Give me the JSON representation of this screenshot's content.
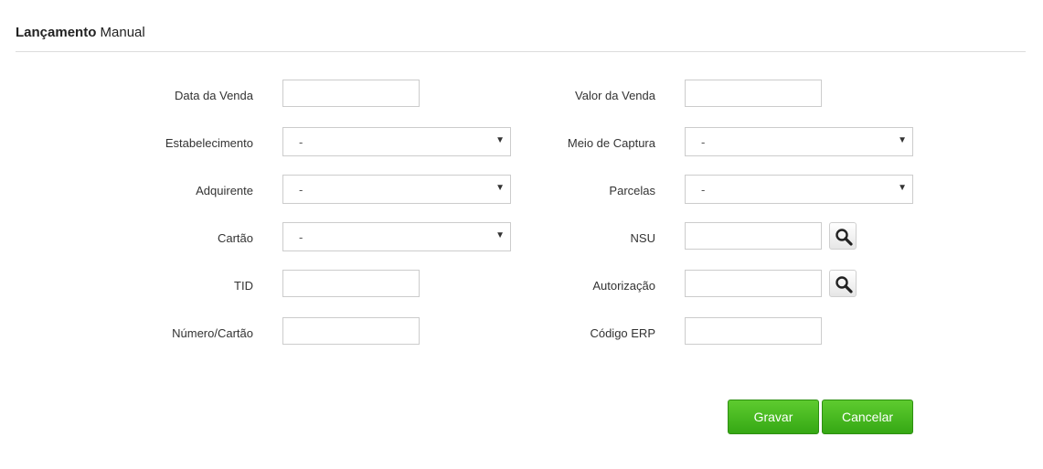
{
  "header": {
    "title_bold": "Lançamento",
    "title_rest": "Manual"
  },
  "form": {
    "left": {
      "data_venda": {
        "label": "Data da Venda",
        "value": ""
      },
      "estabelecimento": {
        "label": "Estabelecimento",
        "value": "-"
      },
      "adquirente": {
        "label": "Adquirente",
        "value": "-"
      },
      "cartao": {
        "label": "Cartão",
        "value": "-"
      },
      "tid": {
        "label": "TID",
        "value": ""
      },
      "numero_cartao": {
        "label": "Número/Cartão",
        "value": ""
      }
    },
    "right": {
      "valor_venda": {
        "label": "Valor da Venda",
        "value": ""
      },
      "meio_captura": {
        "label": "Meio de Captura",
        "value": "-"
      },
      "parcelas": {
        "label": "Parcelas",
        "value": "-"
      },
      "nsu": {
        "label": "NSU",
        "value": ""
      },
      "autorizacao": {
        "label": "Autorização",
        "value": ""
      },
      "codigo_erp": {
        "label": "Código ERP",
        "value": ""
      }
    }
  },
  "icons": {
    "select_arrow": "▼",
    "lookup": "search-icon"
  },
  "buttons": {
    "gravar": "Gravar",
    "cancelar": "Cancelar"
  },
  "colors": {
    "button_green": "#3fb31c",
    "border": "#cccccc"
  }
}
